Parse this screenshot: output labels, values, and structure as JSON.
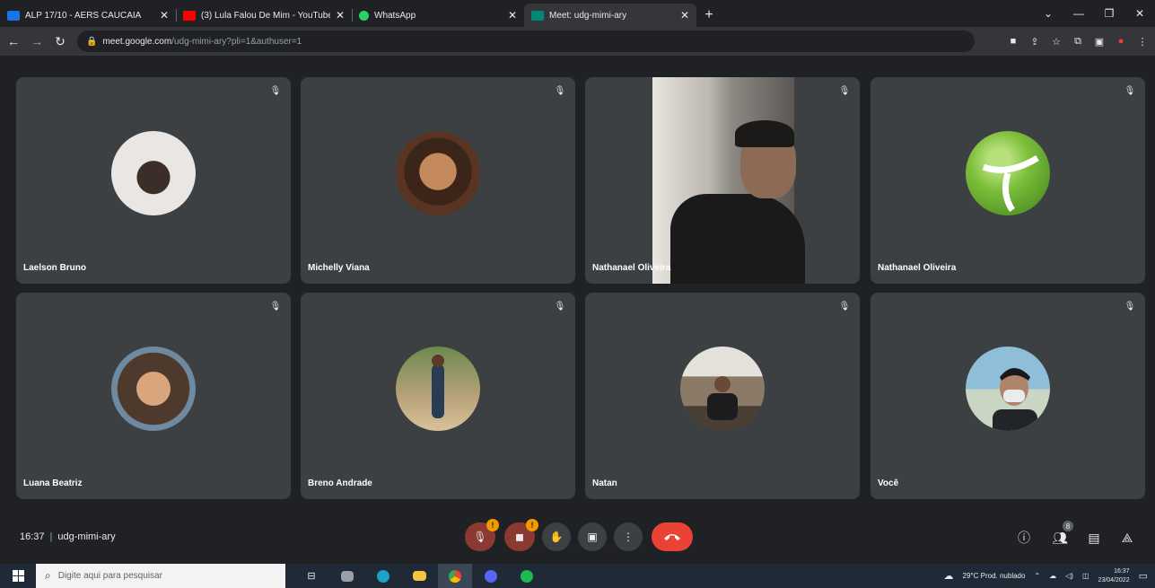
{
  "browser": {
    "tabs": [
      {
        "title": "ALP 17/10 - AERS CAUCAIA",
        "color": "#1a73e8",
        "active": false
      },
      {
        "title": "(3) Lula Falou De Mim - YouTube",
        "color": "#ff0000",
        "active": false
      },
      {
        "title": "WhatsApp",
        "color": "#25d366",
        "active": false
      },
      {
        "title": "Meet: udg-mimi-ary",
        "color": "#00897b",
        "active": true
      }
    ],
    "url_host": "meet.google.com",
    "url_path": "/udg-mimi-ary?pli=1&authuser=1"
  },
  "meeting": {
    "time": "16:37",
    "code": "udg-mimi-ary"
  },
  "participants": [
    {
      "name": "Laelson Bruno",
      "avatar_colors": [
        "#e9e6e3",
        "#3b2d27"
      ]
    },
    {
      "name": "Michelly Viana",
      "avatar_colors": [
        "#c48a5e",
        "#3a2518"
      ]
    },
    {
      "name": "Nathanael Oliveira",
      "video": true
    },
    {
      "name": "Nathanael Oliveira",
      "avatar_colors": [
        "#7cbf3a",
        "#ffffff"
      ]
    },
    {
      "name": "Luana Beatriz",
      "avatar_colors": [
        "#d8a57c",
        "#4e3a2c"
      ]
    },
    {
      "name": "Breno Andrade",
      "avatar_colors": [
        "#b8a27a",
        "#2a3b55"
      ]
    },
    {
      "name": "Natan",
      "avatar_colors": [
        "#e3e1da",
        "#1d1d1f"
      ]
    },
    {
      "name": "Você",
      "avatar_colors": [
        "#8fbfd8",
        "#222428"
      ]
    }
  ],
  "controls": {
    "mic_badge": "!",
    "cam_badge": "!",
    "people_count": "8"
  },
  "taskbar": {
    "search_placeholder": "Digite aqui para pesquisar",
    "weather": "29°C  Prod. nublado",
    "clock_time": "16:37",
    "clock_date": "23/04/2022"
  }
}
